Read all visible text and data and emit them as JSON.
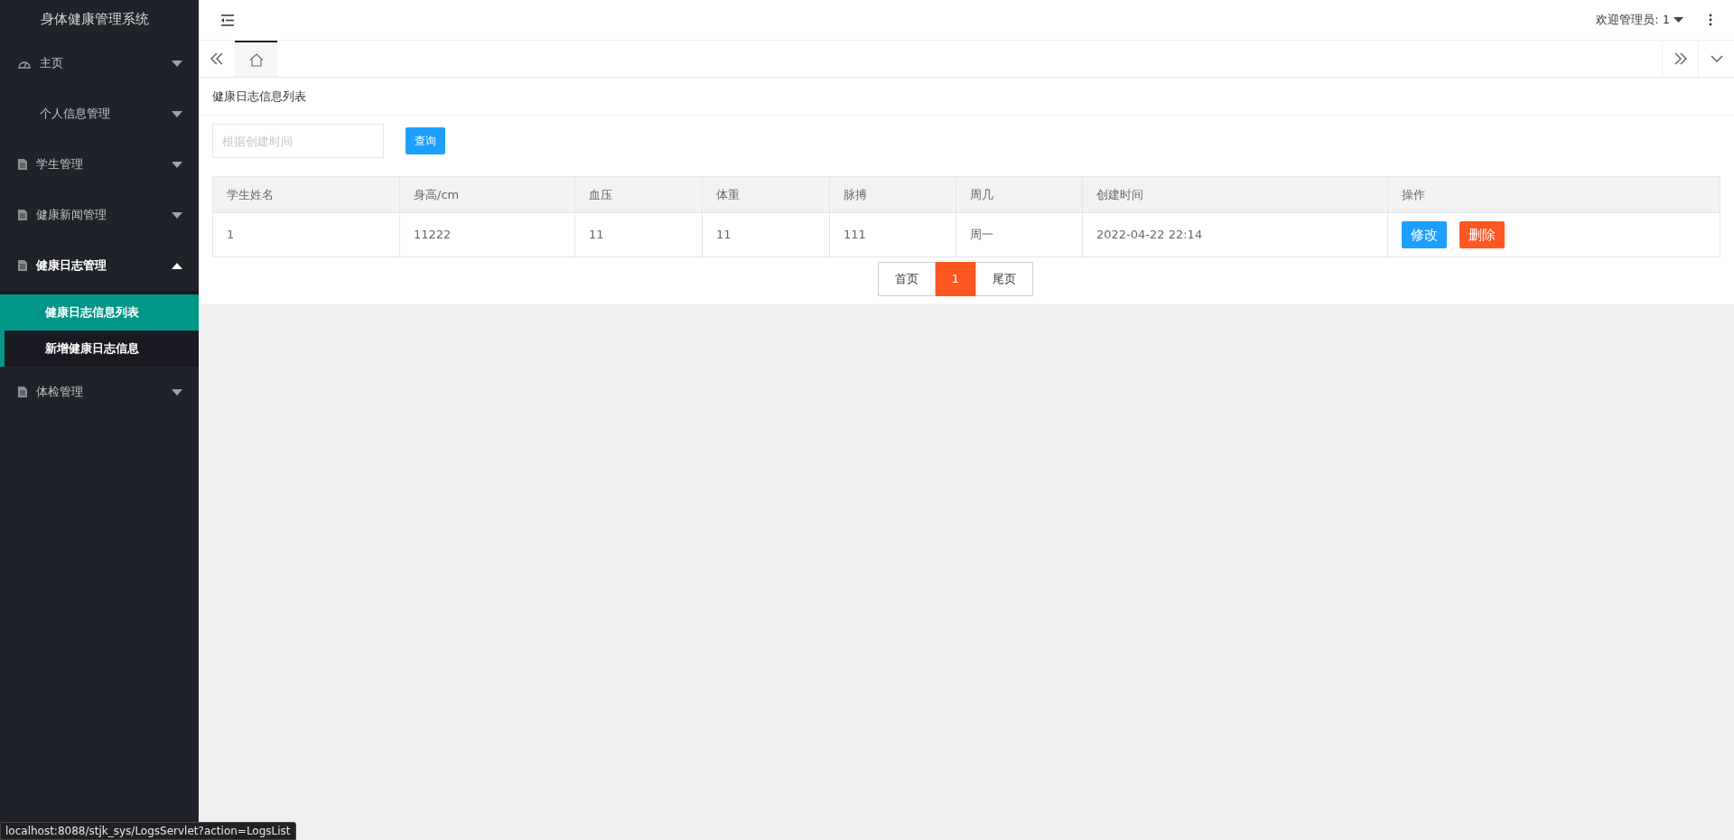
{
  "sidebar": {
    "title": "身体健康管理系统",
    "items": [
      {
        "label": "主页",
        "kind": "dashboard",
        "expanded": false
      },
      {
        "label": "个人信息管理",
        "kind": "plain",
        "expanded": false
      },
      {
        "label": "学生管理",
        "kind": "document",
        "expanded": false
      },
      {
        "label": "健康新闻管理",
        "kind": "document",
        "expanded": false
      },
      {
        "label": "健康日志管理",
        "kind": "document",
        "expanded": true,
        "children": [
          {
            "label": "健康日志信息列表",
            "selected": true
          },
          {
            "label": "新增健康日志信息",
            "selected": false
          }
        ]
      },
      {
        "label": "体检管理",
        "kind": "document",
        "expanded": false
      }
    ]
  },
  "header": {
    "user": "欢迎管理员: 1"
  },
  "panel": {
    "title": "健康日志信息列表",
    "search": {
      "placeholder": "根据创建时间",
      "button": "查询"
    }
  },
  "table": {
    "columns": [
      "学生姓名",
      "身高/cm",
      "血压",
      "体重",
      "脉搏",
      "周几",
      "创建时间",
      "操作"
    ],
    "rows": [
      {
        "cells": [
          "1",
          "11222",
          "11",
          "11",
          "111",
          "周一",
          "2022-04-22 22:14"
        ],
        "actions": [
          "修改",
          "删除"
        ]
      }
    ]
  },
  "pagination": {
    "first": "首页",
    "pages": [
      {
        "label": "1",
        "selected": true
      }
    ],
    "last": "尾页"
  },
  "status_bar": "localhost:8088/stjk_sys/LogsServlet?action=LogsList"
}
